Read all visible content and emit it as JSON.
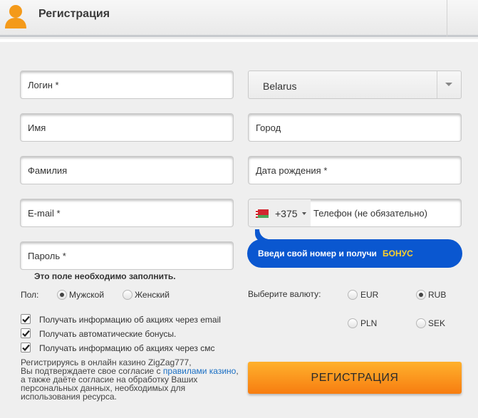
{
  "header": {
    "title": "Регистрация",
    "icon": "user-icon"
  },
  "fields": {
    "login": "Логин *",
    "first_name": "Имя",
    "last_name": "Фамилия",
    "email": "E-mail *",
    "password": "Пароль *",
    "city": "Город",
    "birth_date": "Дата рождения *",
    "phone": "Телефон (не обязательно)"
  },
  "country": {
    "selected": "Belarus"
  },
  "phone_code": {
    "dial": "+375",
    "flag": "belarus-flag-icon"
  },
  "bonus_banner": {
    "text": "Введи свой номер и получи",
    "keyword": "БОНУС"
  },
  "validation": {
    "password_error": "Это поле необходимо заполнить."
  },
  "gender": {
    "label": "Пол:",
    "options": [
      "Мужской",
      "Женский"
    ],
    "selected": "Мужской"
  },
  "currency": {
    "label": "Выберите валюту:",
    "options": [
      "EUR",
      "RUB",
      "PLN",
      "SEK"
    ],
    "selected": "RUB"
  },
  "checkboxes": [
    {
      "label": "Получать информацию об акциях через email",
      "checked": true
    },
    {
      "label": "Получать автоматические бонусы.",
      "checked": true
    },
    {
      "label": "Получать информацию об акциях через смс",
      "checked": true
    }
  ],
  "terms": {
    "line1": "Регистрируясь в онлайн казино ZigZag777,",
    "line2": "Вы подтверждаете свое согласие с",
    "link": "правилами казино",
    "line3": ", а также даёте согласие на обработку Ваших персональных данных, необходимых для использования ресурса."
  },
  "submit_button": "РЕГИСТРАЦИЯ",
  "colors": {
    "accent": "#0a57d0",
    "bonus_keyword": "#ffd12a",
    "button": "#f9931a",
    "link": "#1a6fc4"
  }
}
